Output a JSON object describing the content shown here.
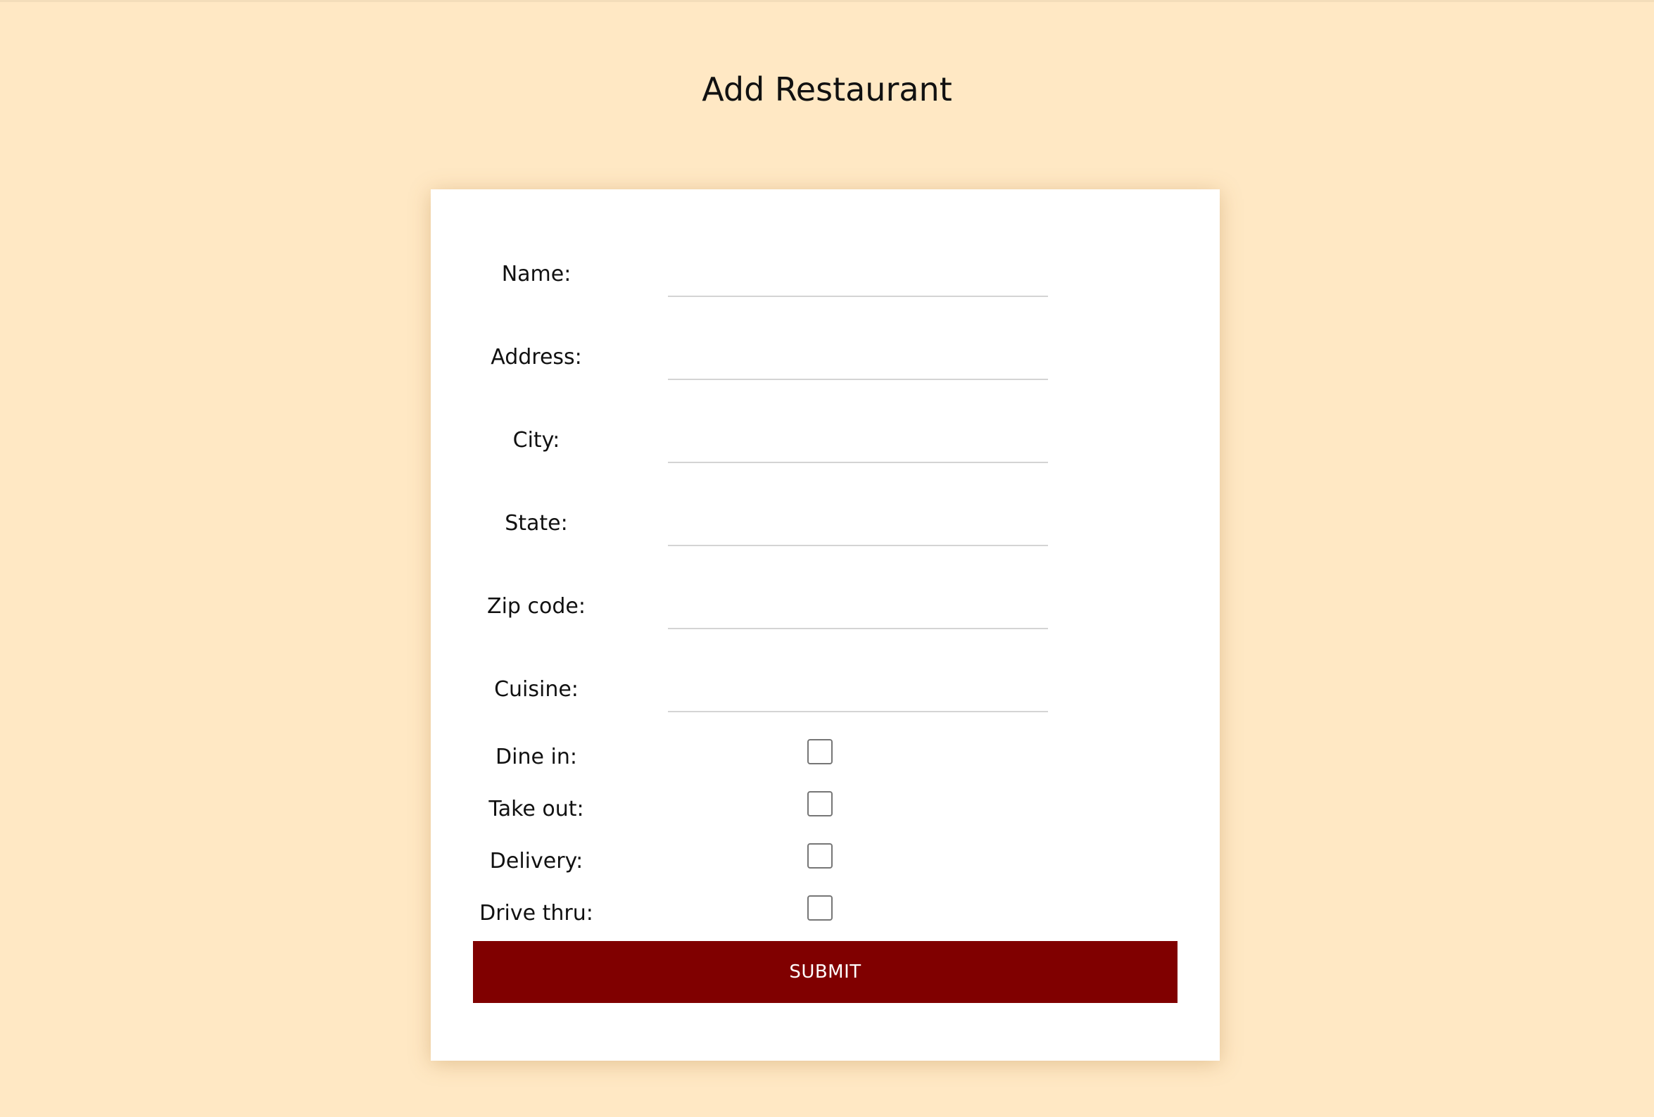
{
  "page": {
    "title": "Add Restaurant",
    "background_color": "#ffe8c4"
  },
  "form": {
    "text_fields": [
      {
        "label": "Name:",
        "value": "",
        "placeholder": ""
      },
      {
        "label": "Address:",
        "value": "",
        "placeholder": ""
      },
      {
        "label": "City:",
        "value": "",
        "placeholder": ""
      },
      {
        "label": "State:",
        "value": "",
        "placeholder": ""
      },
      {
        "label": "Zip code:",
        "value": "",
        "placeholder": ""
      },
      {
        "label": "Cuisine:",
        "value": "",
        "placeholder": ""
      }
    ],
    "checkboxes": [
      {
        "label": "Dine in:",
        "checked": false
      },
      {
        "label": "Take out:",
        "checked": false
      },
      {
        "label": "Delivery:",
        "checked": false
      },
      {
        "label": "Drive thru:",
        "checked": false
      }
    ],
    "submit_label": "SUBMIT",
    "submit_color": "#800000"
  }
}
